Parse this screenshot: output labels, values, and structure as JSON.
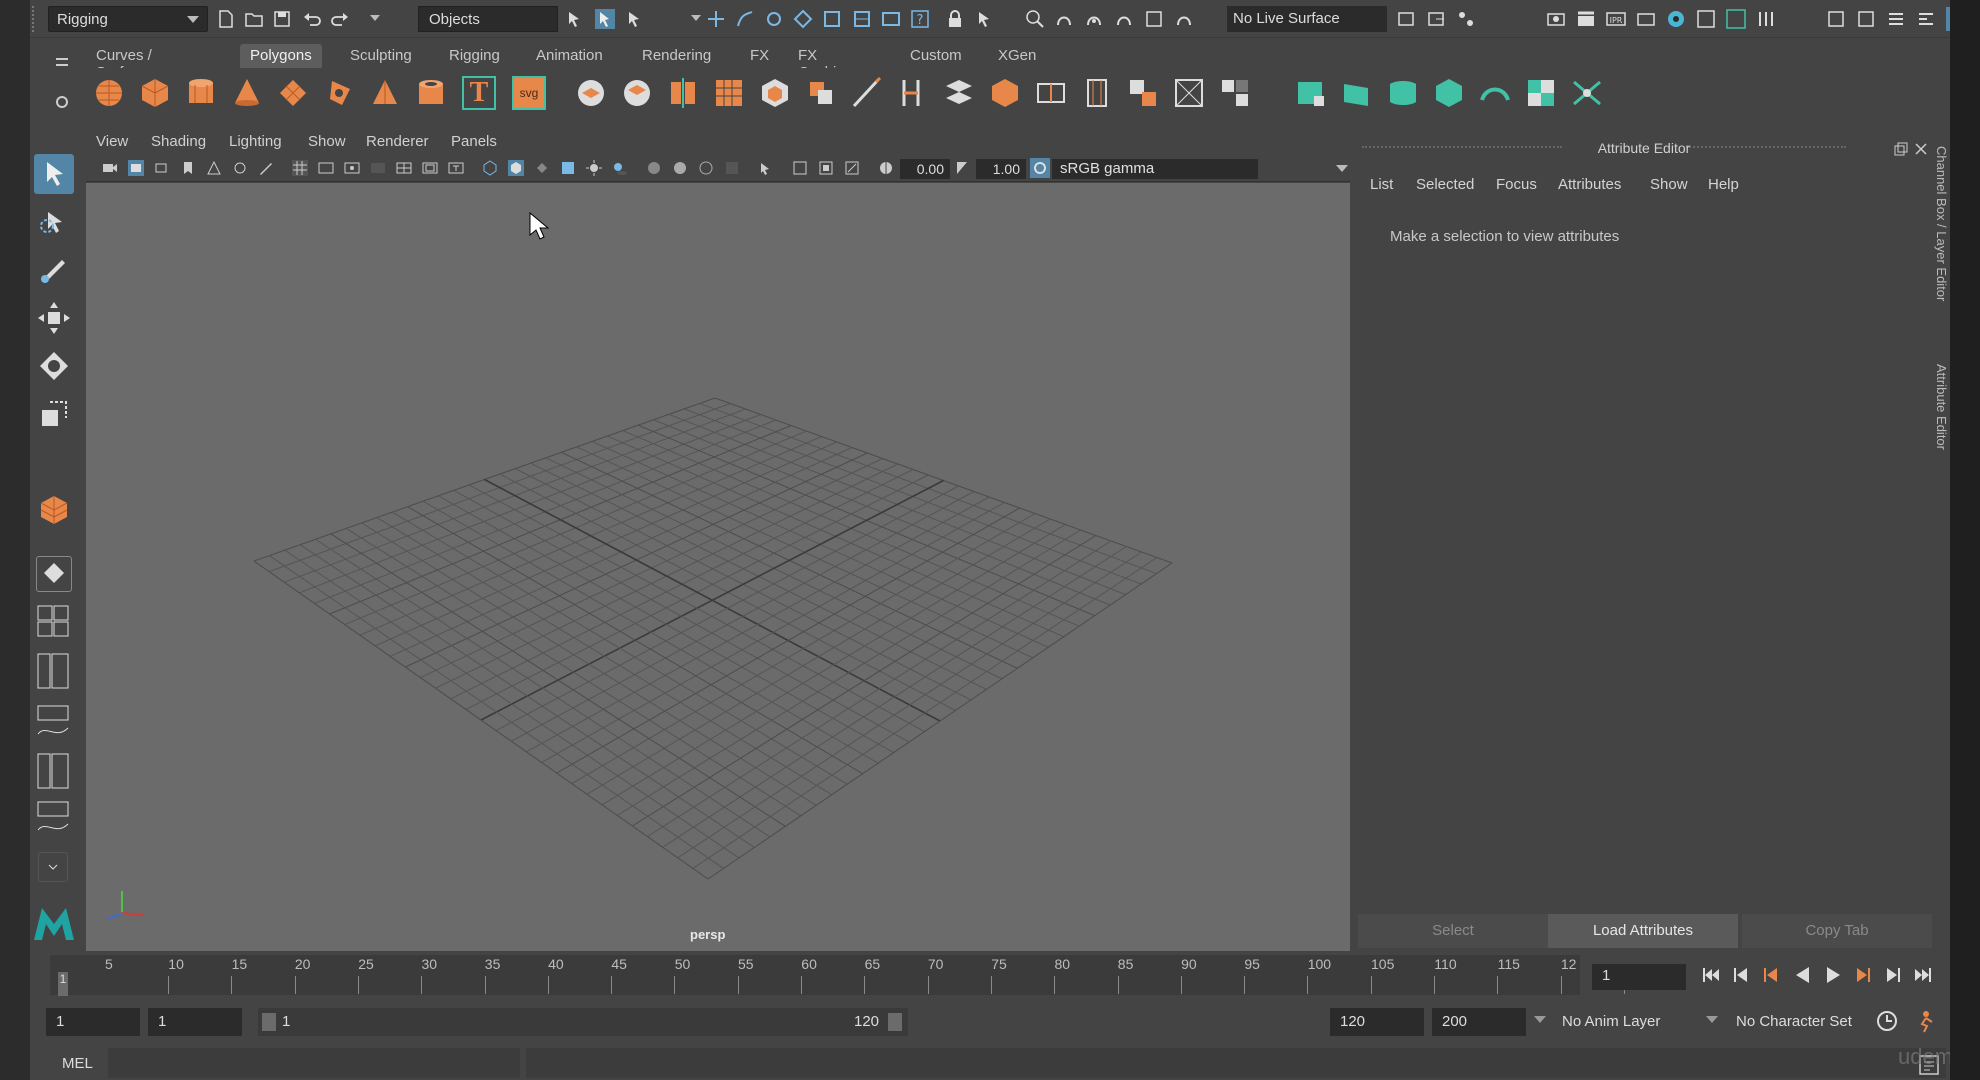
{
  "status_line": {
    "menu_set": "Rigging",
    "selection_mode": "Objects",
    "live_surface": "No Live Surface"
  },
  "shelf": {
    "tabs": [
      {
        "label": "Curves / Surfaces"
      },
      {
        "label": "Polygons",
        "active": true
      },
      {
        "label": "Sculpting"
      },
      {
        "label": "Rigging"
      },
      {
        "label": "Animation"
      },
      {
        "label": "Rendering"
      },
      {
        "label": "FX"
      },
      {
        "label": "FX Caching"
      },
      {
        "label": "Custom"
      },
      {
        "label": "XGen"
      }
    ],
    "text_tool_label": "T",
    "svg_tool_label": "svg"
  },
  "viewport": {
    "menus": [
      "View",
      "Shading",
      "Lighting",
      "Show",
      "Renderer",
      "Panels"
    ],
    "exposure": "0.00",
    "gamma_value": "1.00",
    "color_space": "sRGB gamma",
    "camera_label": "persp"
  },
  "attribute_editor": {
    "title": "Attribute Editor",
    "menus": [
      "List",
      "Selected",
      "Focus",
      "Attributes",
      "Show",
      "Help"
    ],
    "message": "Make a selection to view attributes",
    "buttons": {
      "select": "Select",
      "load": "Load Attributes",
      "copy_tab": "Copy Tab"
    },
    "side_tabs": [
      "Channel Box / Layer Editor",
      "Attribute Editor"
    ]
  },
  "time_slider": {
    "ticks": [
      "5",
      "10",
      "15",
      "20",
      "25",
      "30",
      "35",
      "40",
      "45",
      "50",
      "55",
      "60",
      "65",
      "70",
      "75",
      "80",
      "85",
      "90",
      "95",
      "100",
      "105",
      "110",
      "115",
      "12"
    ],
    "current_frame_marker": "1",
    "current_frame": "1"
  },
  "range_slider": {
    "start_frame": "1",
    "playback_start": "1",
    "range_start_label": "1",
    "range_end_label": "120",
    "playback_end": "120",
    "end_frame": "200",
    "anim_layer": "No Anim Layer",
    "character_set": "No Character Set"
  },
  "command_line": {
    "language": "MEL"
  },
  "watermark": "udemy",
  "colors": {
    "shelf_orange": "#e8874a",
    "teal_shelf": "#41c2a6",
    "active_tool": "#5285a6"
  }
}
